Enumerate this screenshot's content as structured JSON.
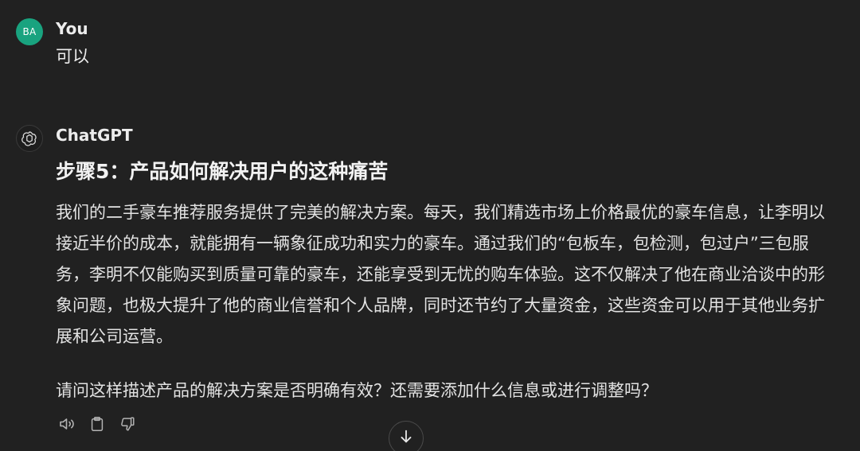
{
  "conversation": {
    "user_message": {
      "avatar_initials": "BA",
      "author": "You",
      "text": "可以"
    },
    "assistant_message": {
      "author": "ChatGPT",
      "avatar_icon": "openai-logo-icon",
      "heading": "步骤5：产品如何解决用户的这种痛苦",
      "paragraph": "我们的二手豪车推荐服务提供了完美的解决方案。每天，我们精选市场上价格最优的豪车信息，让李明以接近半价的成本，就能拥有一辆象征成功和实力的豪车。通过我们的“包板车，包检测，包过户”三包服务，李明不仅能购买到质量可靠的豪车，还能享受到无忧的购车体验。这不仅解决了他在商业洽谈中的形象问题，也极大提升了他的商业信誉和个人品牌，同时还节约了大量资金，这些资金可以用于其他业务扩展和公司运营。",
      "question": "请问这样描述产品的解决方案是否明确有效？还需要添加什么信息或进行调整吗？"
    }
  },
  "actions": {
    "icons": [
      "read-aloud-icon",
      "copy-icon",
      "thumbs-down-icon"
    ]
  },
  "scroll_button": {
    "icon": "arrow-down-icon"
  },
  "colors": {
    "background": "#212121",
    "user_avatar": "#19a37f",
    "text": "#ececec"
  }
}
